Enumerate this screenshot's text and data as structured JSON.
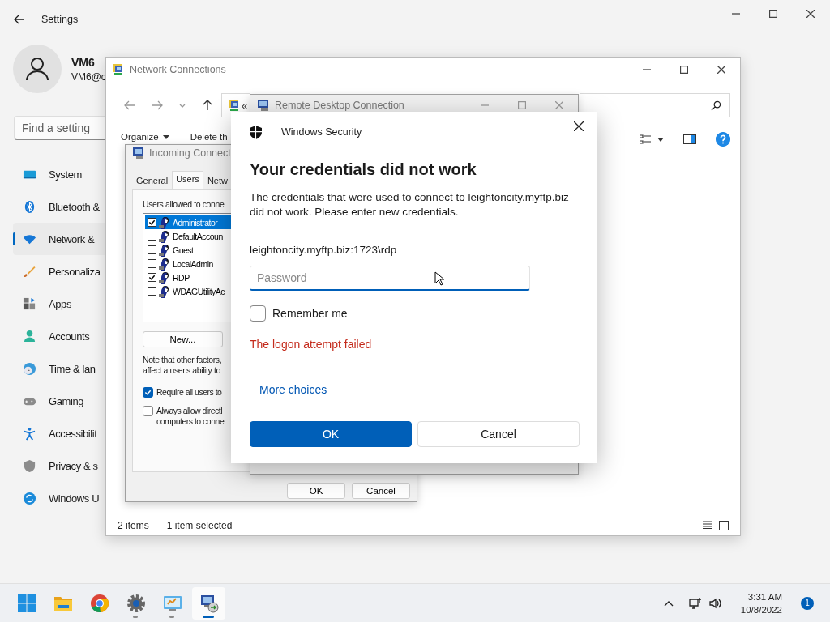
{
  "settings": {
    "title": "Settings",
    "user": {
      "name": "VM6",
      "email": "VM6@c"
    },
    "search": {
      "placeholder": "Find a setting"
    },
    "nav": [
      {
        "kind": "system",
        "label": "System",
        "selected": false
      },
      {
        "kind": "bluetooth",
        "label": "Bluetooth &",
        "selected": false
      },
      {
        "kind": "network",
        "label": "Network &",
        "selected": true
      },
      {
        "kind": "personalization",
        "label": "Personaliza",
        "selected": false
      },
      {
        "kind": "apps",
        "label": "Apps",
        "selected": false
      },
      {
        "kind": "accounts",
        "label": "Accounts",
        "selected": false
      },
      {
        "kind": "time",
        "label": "Time & lan",
        "selected": false
      },
      {
        "kind": "gaming",
        "label": "Gaming",
        "selected": false
      },
      {
        "kind": "accessibility",
        "label": "Accessibilit",
        "selected": false
      },
      {
        "kind": "privacy",
        "label": "Privacy & s",
        "selected": false
      },
      {
        "kind": "update",
        "label": "Windows U",
        "selected": false
      }
    ]
  },
  "network_connections": {
    "title": "Network Connections",
    "address_prefix": "«",
    "toolbar": [
      "Organize",
      "Delete th"
    ],
    "status": [
      "2 items",
      "1 item selected"
    ]
  },
  "incoming_connections": {
    "title": "Incoming Connect",
    "tabs": [
      {
        "label": "General",
        "selected": false
      },
      {
        "label": "Users",
        "selected": true
      },
      {
        "label": "Netw",
        "selected": false
      }
    ],
    "users_label": "Users allowed to conne",
    "users": [
      {
        "name": "Administrator",
        "checked": true,
        "selected": true
      },
      {
        "name": "DefaultAccoun",
        "checked": false,
        "selected": false
      },
      {
        "name": "Guest",
        "checked": false,
        "selected": false
      },
      {
        "name": "LocalAdmin",
        "checked": false,
        "selected": false
      },
      {
        "name": "RDP",
        "checked": true,
        "selected": false
      },
      {
        "name": "WDAGUtilityAc",
        "checked": false,
        "selected": false
      }
    ],
    "new_button": "New...",
    "note": [
      "Note that other factors,",
      "affect a user's ability to"
    ],
    "options": [
      {
        "lines": [
          "Require all users to"
        ],
        "checked": true
      },
      {
        "lines": [
          "Always allow directl",
          "computers to conne"
        ],
        "checked": false
      }
    ],
    "buttons": [
      "OK",
      "Cancel"
    ]
  },
  "remote_desktop": {
    "title": "Remote Desktop Connection"
  },
  "security_dialog": {
    "app": "Windows Security",
    "heading": "Your credentials did not work",
    "message": "The credentials that were used to connect to leightoncity.myftp.biz did not work. Please enter new credentials.",
    "username": "leightoncity.myftp.biz:1723\\rdp",
    "password": {
      "placeholder": "Password"
    },
    "remember": {
      "label": "Remember me",
      "checked": false
    },
    "error": "The logon attempt failed",
    "more_choices": "More choices",
    "buttons": [
      {
        "label": "OK",
        "kind": "primary"
      },
      {
        "label": "Cancel",
        "kind": "secondary"
      }
    ]
  },
  "taskbar": {
    "apps": [
      {
        "kind": "start",
        "running": false,
        "active": false
      },
      {
        "kind": "explorer",
        "running": false,
        "active": false
      },
      {
        "kind": "browser",
        "running": false,
        "active": false
      },
      {
        "kind": "settings",
        "running": true,
        "active": false
      },
      {
        "kind": "control-panel",
        "running": true,
        "active": false
      },
      {
        "kind": "remote-desktop",
        "running": true,
        "active": true
      }
    ],
    "time": "3:31 AM",
    "date": "10/8/2022",
    "notifications": "1"
  }
}
